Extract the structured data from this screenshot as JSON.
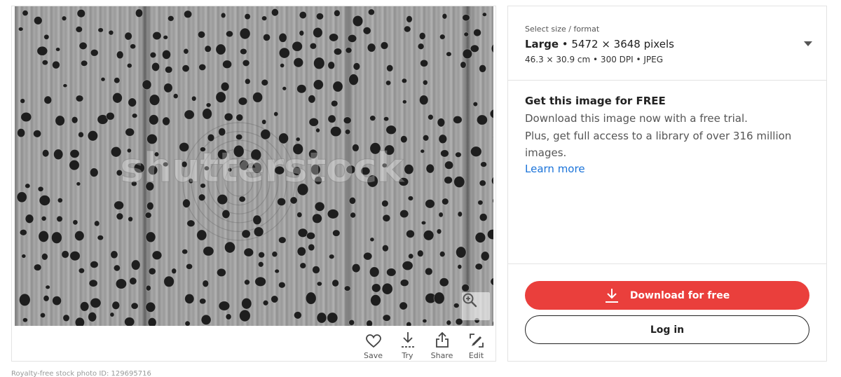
{
  "image": {
    "watermark": "shutterstock",
    "zoom_icon": "zoom-in-icon"
  },
  "actions": [
    {
      "label": "Save",
      "icon": "heart-icon"
    },
    {
      "label": "Try",
      "icon": "download-try-icon"
    },
    {
      "label": "Share",
      "icon": "share-icon"
    },
    {
      "label": "Edit",
      "icon": "edit-icon"
    }
  ],
  "size_select": {
    "caption": "Select size / format",
    "size_name": "Large",
    "pixels": "• 5472 × 3648 pixels",
    "details": "46.3 × 30.9 cm • 300 DPI • JPEG",
    "caret_icon": "caret-down-icon"
  },
  "promo": {
    "title": "Get this image for FREE",
    "line1": "Download this image now with a free trial.",
    "line2": "Plus, get full access to a library of over 316 million images.",
    "link": "Learn more"
  },
  "buttons": {
    "download": "Download for free",
    "login": "Log in"
  },
  "colors": {
    "accent": "#ea3f3c",
    "link": "#1a73d9"
  },
  "footer": {
    "text": "Royalty-free stock photo ID: 129695716"
  }
}
